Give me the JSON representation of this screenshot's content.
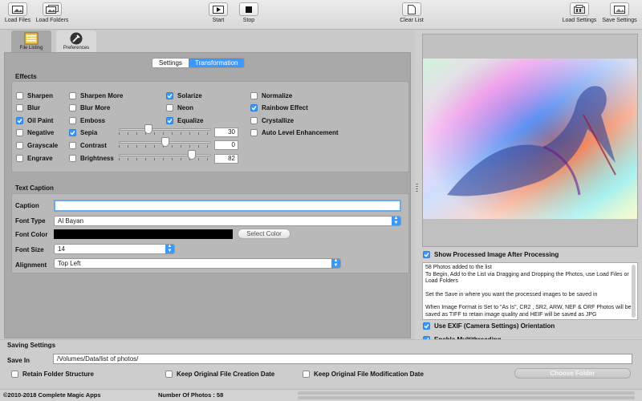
{
  "toolbar": {
    "load_files": "Load Files",
    "load_folders": "Load Folders",
    "start": "Start",
    "stop": "Stop",
    "clear_list": "Clear List",
    "load_settings": "Load Settings",
    "save_settings": "Save Settings"
  },
  "tabs": {
    "file_listing": "File Listing",
    "preferences": "Preferences"
  },
  "segmented": {
    "settings": "Settings",
    "transformation": "Transformation",
    "selected": "Transformation"
  },
  "effects": {
    "title": "Effects",
    "col1": [
      {
        "label": "Sharpen",
        "checked": false
      },
      {
        "label": "Blur",
        "checked": false
      },
      {
        "label": "Oil Paint",
        "checked": true
      },
      {
        "label": "Negative",
        "checked": false
      },
      {
        "label": "Grayscale",
        "checked": false
      },
      {
        "label": "Engrave",
        "checked": false
      }
    ],
    "col2": [
      {
        "label": "Sharpen More",
        "checked": false
      },
      {
        "label": "Blur More",
        "checked": false
      },
      {
        "label": "Emboss",
        "checked": false
      },
      {
        "label": "Sepia",
        "checked": true
      },
      {
        "label": "Contrast",
        "checked": false
      },
      {
        "label": "Brightness",
        "checked": false
      }
    ],
    "col3": [
      {
        "label": "Solarize",
        "checked": true
      },
      {
        "label": "Neon",
        "checked": false
      },
      {
        "label": "Equalize",
        "checked": true
      }
    ],
    "col4": [
      {
        "label": "Normalize",
        "checked": false
      },
      {
        "label": "Rainbow Effect",
        "checked": true
      },
      {
        "label": "Crystallize",
        "checked": false
      },
      {
        "label": "Auto Level Enhancement",
        "checked": false
      }
    ],
    "sepia_value": "30",
    "contrast_value": "0",
    "brightness_value": "82",
    "sepia_fraction": 0.3,
    "contrast_fraction": 0.5,
    "brightness_fraction": 0.82
  },
  "caption": {
    "title": "Text Caption",
    "caption_label": "Caption",
    "caption_value": "",
    "font_type_label": "Font Type",
    "font_type_value": "Al Bayan",
    "font_color_label": "Font Color",
    "font_color_value": "#000000",
    "select_color": "Select Color",
    "font_size_label": "Font Size",
    "font_size_value": "14",
    "alignment_label": "Alignment",
    "alignment_value": "Top Left"
  },
  "right": {
    "show_processed": "Show Processed Image After Processing",
    "show_processed_checked": true,
    "log": [
      "58 Photos added to the list\nTo Begin, Add to the List via Dragging and Dropping the Photos, use Load Files or Load Folders",
      "Set the Save in where you want the processed images to be saved in",
      "When Image Format is Set to \"As Is\", CR2 , SR2, ARW, NEF & ORF Photos will be saved as TIFF to retain image quality and HEIF will be saved as JPG"
    ],
    "use_exif": "Use EXIF (Camera Settings) Orientation",
    "multithreading": "Enable Multithreading"
  },
  "saving": {
    "title": "Saving Settings",
    "save_in_label": "Save In",
    "save_in_value": "/Volumes/Data/list of photos/",
    "retain_structure": "Retain Folder Structure",
    "keep_creation": "Keep Original File Creation Date",
    "keep_modification": "Keep Original File Modification Date",
    "choose_folder": "Choose Folder"
  },
  "status": {
    "copyright": "©2010-2018 Complete Magic Apps",
    "photo_count": "Number Of Photos : 58"
  },
  "colors": {
    "accent": "#3b99fc"
  }
}
